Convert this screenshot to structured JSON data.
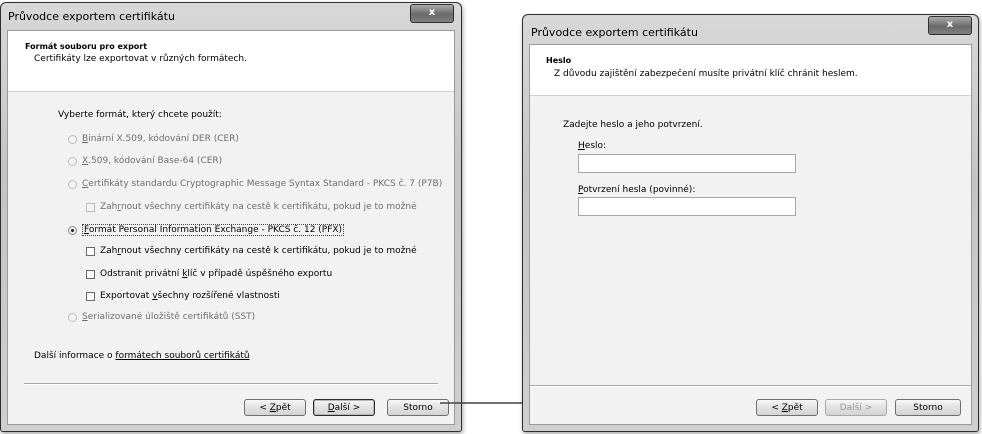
{
  "left_window": {
    "title": "Průvodce exportem certifikátu",
    "close_label": "x",
    "header_title": "Formát souboru pro export",
    "header_subtitle": "Certifikáty lze exportovat v různých formátech.",
    "prompt": "Vyberte formát, který chcete použít:",
    "options": [
      {
        "accel": "B",
        "label": "inární X.509, kódování DER (CER)",
        "selected": false,
        "enabled": false
      },
      {
        "accel": "X",
        "label": ".509, kódování Base-64 (CER)",
        "selected": false,
        "enabled": false
      },
      {
        "accel": "C",
        "label": "ertifikáty standardu Cryptographic Message Syntax Standard - PKCS č. 7 (P7B)",
        "selected": false,
        "enabled": false
      },
      {
        "accel": "F",
        "label": "ormát Personal Information Exchange - PKCS č. 12 (PFX)",
        "selected": true,
        "enabled": true
      },
      {
        "accel": "S",
        "label": "erializované úložiště certifikátů (SST)",
        "selected": false,
        "enabled": false
      }
    ],
    "checkboxes": {
      "p7b_include": {
        "pre": "Zah",
        "accel": "r",
        "post": "nout všechny certifikáty na cestě k certifikátu, pokud je to možné",
        "checked": false,
        "enabled": false
      },
      "pfx_include": {
        "pre": "Zah",
        "accel": "r",
        "post": "nout všechny certifikáty na cestě k certifikátu, pokud je to možné",
        "checked": false,
        "enabled": true
      },
      "pfx_delete_key": {
        "pre": "Odstranit privátní ",
        "accel": "k",
        "post": "líč v případě úspěšného exportu",
        "checked": false,
        "enabled": true
      },
      "pfx_export_ext": {
        "pre": "Exportovat ",
        "accel": "v",
        "post": "šechny rozšířené vlastnosti",
        "checked": false,
        "enabled": true
      }
    },
    "more_info_text": "Další informace o ",
    "more_info_link": "formátech souborů certifikátů",
    "buttons": {
      "back": {
        "pre": "< ",
        "accel": "Z",
        "post": "pět"
      },
      "next": {
        "accel": "D",
        "post": "alší >"
      },
      "cancel": "Storno"
    }
  },
  "right_window": {
    "title": "Průvodce exportem certifikátu",
    "close_label": "x",
    "header_title": "Heslo",
    "header_subtitle": "Z důvodu zajištění zabezpečení musíte privátní klíč chránit heslem.",
    "prompt": "Zadejte heslo a jeho potvrzení.",
    "password_label": {
      "accel": "H",
      "post": "eslo:"
    },
    "password_value": "",
    "confirm_label": {
      "accel": "P",
      "post": "otvrzení hesla (povinné):"
    },
    "confirm_value": "",
    "buttons": {
      "back": {
        "pre": "< ",
        "accel": "Z",
        "post": "pět"
      },
      "next": "Další >",
      "cancel": "Storno"
    }
  },
  "colors": {
    "arrow": "#444444",
    "client_bg": "#f2f2f2",
    "header_bg": "#ffffff"
  }
}
